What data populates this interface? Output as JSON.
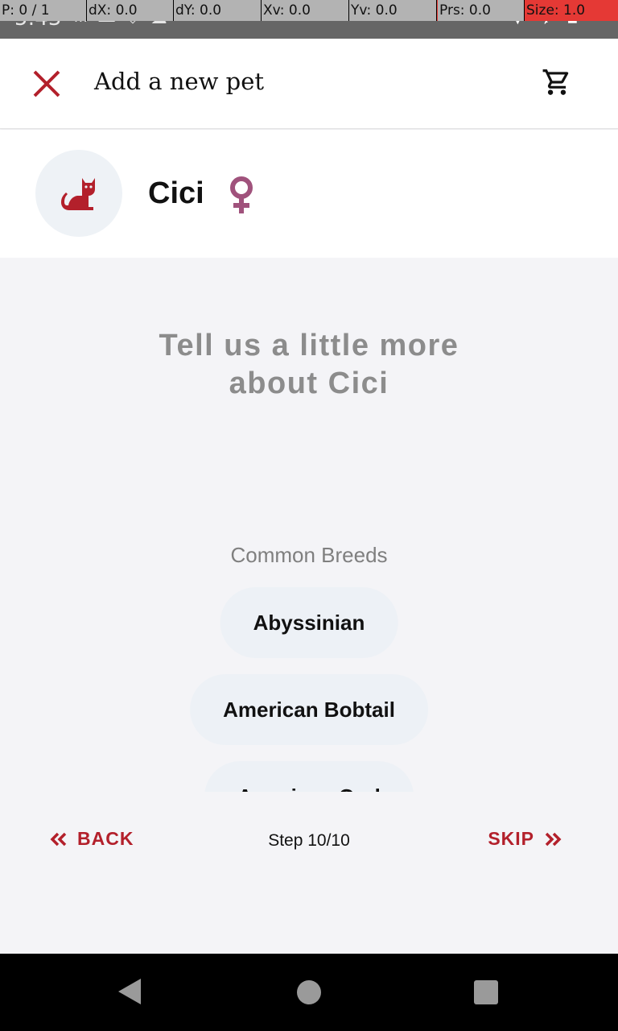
{
  "status_bar": {
    "time": "5:43",
    "debug": {
      "p": "P: 0 / 1",
      "dx": "dX: 0.0",
      "dy": "dY: 0.0",
      "xv": "Xv: 0.0",
      "yv": "Yv: 0.0",
      "prs": "Prs: 0.0",
      "size": "Size: 1.0"
    }
  },
  "appbar": {
    "title": "Add a new pet",
    "close_icon": "close-icon",
    "cart_icon": "shopping-cart-icon"
  },
  "pet": {
    "name": "Cici",
    "avatar_icon": "cat-icon",
    "gender_icon": "female-icon"
  },
  "main": {
    "heading_line1": "Tell us a little more",
    "heading_line2": "about Cici",
    "breeds_title": "Common Breeds",
    "breeds": [
      "Abyssinian",
      "American Bobtail",
      "American Curl"
    ]
  },
  "footer_nav": {
    "back_label": "BACK",
    "step_label": "Step 10/10",
    "skip_label": "SKIP"
  },
  "colors": {
    "accent": "#b3202b",
    "gender": "#a0527c",
    "chip_bg": "#edf1f6",
    "page_bg": "#f4f4f7"
  }
}
